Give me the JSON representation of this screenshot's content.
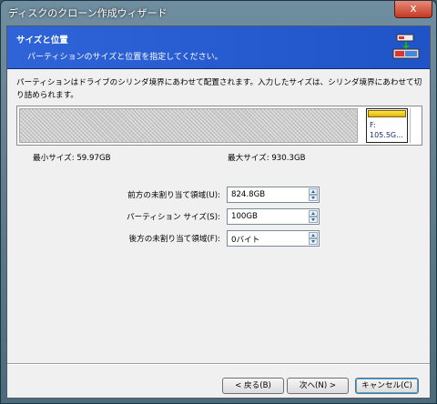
{
  "window": {
    "title": "ディスクのクローン作成ウィザード",
    "close_glyph": "x"
  },
  "header": {
    "title": "サイズと位置",
    "subtitle": "パーティションのサイズと位置を指定してください。",
    "icon": "disk-clone-icon"
  },
  "description": "パーティションはドライブのシリンダ境界にあわせて配置されます。入力したサイズは、シリンダ境界にあわせて切り詰められます。",
  "partition_map": {
    "partition_letter": "F:",
    "partition_size": "105.5G...",
    "cap_color": "#f0c800"
  },
  "min_size": "最小サイズ:  59.97GB",
  "max_size": "最大サイズ:  930.3GB",
  "fields": {
    "before": {
      "label": "前方の未割り当て領域(U):",
      "value": "824.8GB"
    },
    "size": {
      "label": "パーティション サイズ(S):",
      "value": "100GB"
    },
    "after": {
      "label": "後方の未割り当て領域(F):",
      "value": "0バイト"
    }
  },
  "buttons": {
    "back": "< 戻る(B)",
    "next": "次へ(N) >",
    "cancel": "キャンセル(C)"
  },
  "colors": {
    "header_blue": "#2660d6",
    "title_close_red": "#c8402a"
  }
}
